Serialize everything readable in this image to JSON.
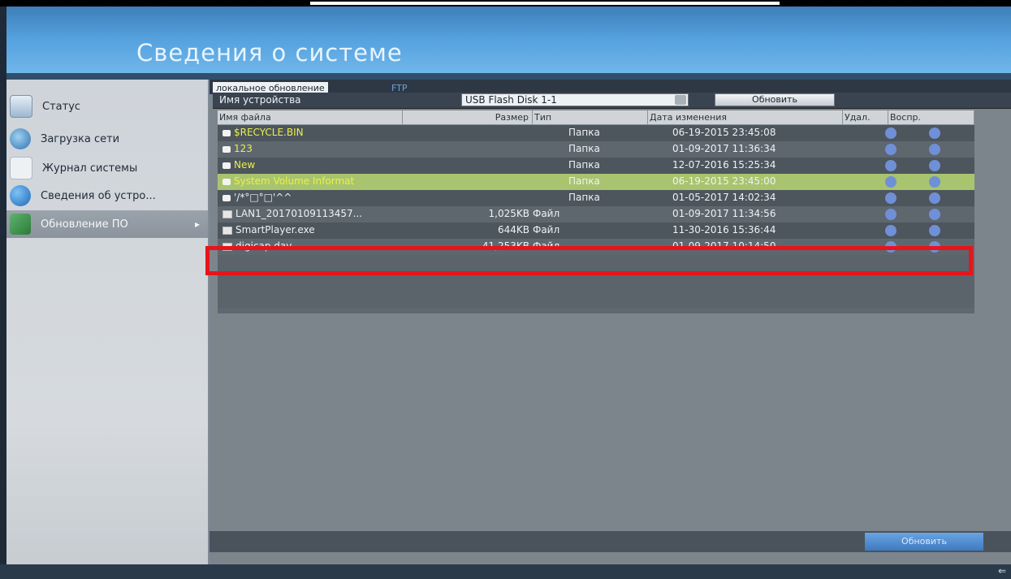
{
  "window": {
    "title": "Сведения о системе"
  },
  "sidebar": {
    "items": [
      {
        "label": "Статус",
        "icon": "status-icon"
      },
      {
        "label": "Загрузка сети",
        "icon": "network-icon"
      },
      {
        "label": "Журнал системы",
        "icon": "log-icon"
      },
      {
        "label": "Сведения об устро...",
        "icon": "info-icon"
      },
      {
        "label": "Обновление ПО",
        "icon": "upgrade-icon"
      }
    ],
    "active_arrow": "▸"
  },
  "tabs": [
    {
      "label": "локальное обновление"
    },
    {
      "label": "FTP"
    }
  ],
  "device": {
    "label": "Имя устройства",
    "value": "USB Flash Disk 1-1",
    "refresh_label": "Обновить"
  },
  "table": {
    "headers": [
      "Имя файла",
      "Размер",
      "Тип",
      "Дата изменения",
      "Удал.",
      "Воспр."
    ],
    "rows": [
      {
        "name": "$RECYCLE.BIN",
        "size": "",
        "type": "Папка",
        "date": "06-19-2015 23:45:08"
      },
      {
        "name": "123",
        "size": "",
        "type": "Папка",
        "date": "01-09-2017 11:36:34"
      },
      {
        "name": "New",
        "size": "",
        "type": "Папка",
        "date": "12-07-2016 15:25:34"
      },
      {
        "name": "System Volume Informat",
        "size": "",
        "type": "Папка",
        "date": "06-19-2015 23:45:00"
      },
      {
        "name": "'/*°□°□'^^",
        "size": "",
        "type": "Папка",
        "date": "01-05-2017 14:02:34"
      },
      {
        "name": "LAN1_20170109113457...",
        "size": "1,025KB",
        "type": "Файл",
        "date": "01-09-2017 11:34:56"
      },
      {
        "name": "SmartPlayer.exe",
        "size": "644KB",
        "type": "Файл",
        "date": "11-30-2016 15:36:44"
      },
      {
        "name": "digicap.dav",
        "size": "41,253KB",
        "type": "Файл",
        "date": "01-09-2017 10:14:50"
      }
    ]
  },
  "footer": {
    "button_label": "Обновить"
  },
  "colors": {
    "accent": "#4a88cf",
    "highlight": "#a8c46e",
    "selection": "#e8141b"
  }
}
